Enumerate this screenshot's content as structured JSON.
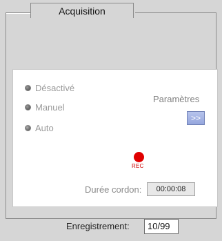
{
  "group": {
    "title": "Acquisition"
  },
  "mode": {
    "options": [
      {
        "label": "Désactivé",
        "selected": false
      },
      {
        "label": "Manuel",
        "selected": false
      },
      {
        "label": "Auto",
        "selected": true
      }
    ]
  },
  "parameters": {
    "label": "Paramètres",
    "button_label": ">>",
    "button_color": "#a6b4e6"
  },
  "recording": {
    "indicator_label": "REC",
    "indicator_color": "#e00000"
  },
  "duration": {
    "label": "Durée cordon:",
    "value": "00:00:08"
  },
  "enregistrement": {
    "label": "Enregistrement:",
    "value": "10/99"
  }
}
